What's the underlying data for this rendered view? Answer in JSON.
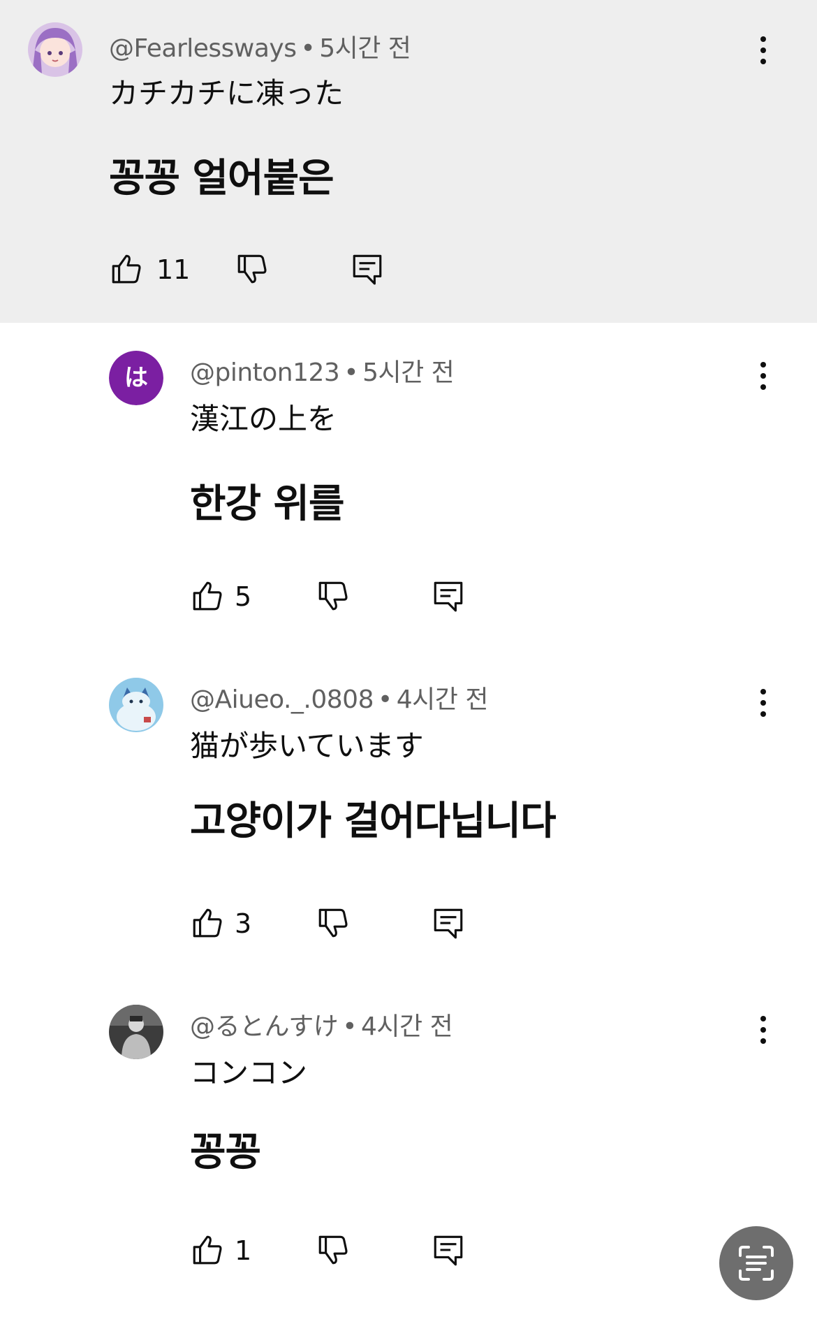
{
  "comments": [
    {
      "handle": "@Fearlessways",
      "time": "5시간 전",
      "japanese": "カチカチに凍った",
      "korean": "꽁꽁 얼어붙은",
      "likes": "11",
      "avatar": "anime-girl-avatar"
    },
    {
      "handle": "@pinton123",
      "time": "5시간 전",
      "japanese": "漢江の上を",
      "korean": "한강 위를",
      "likes": "5",
      "avatar_letter": "は",
      "avatar_color": "#7b1fa2"
    },
    {
      "handle": "@Aiueo._.0808",
      "time": "4시간 전",
      "japanese": "猫が歩いています",
      "korean": "고양이가 걸어다닙니다",
      "likes": "3",
      "avatar": "cat-illustration-avatar"
    },
    {
      "handle": "@るとんすけ",
      "time": "4시간 전",
      "japanese": "コンコン",
      "korean": "꽁꽁",
      "likes": "1",
      "avatar": "person-photo-avatar"
    }
  ],
  "separator": "•",
  "colors": {
    "highlight_bg": "#eeeeee",
    "meta_text": "#606060",
    "fab_bg": "#6e6e6e"
  },
  "icons": [
    "like-icon",
    "dislike-icon",
    "reply-icon",
    "more-vert-icon",
    "scan-text-icon"
  ]
}
